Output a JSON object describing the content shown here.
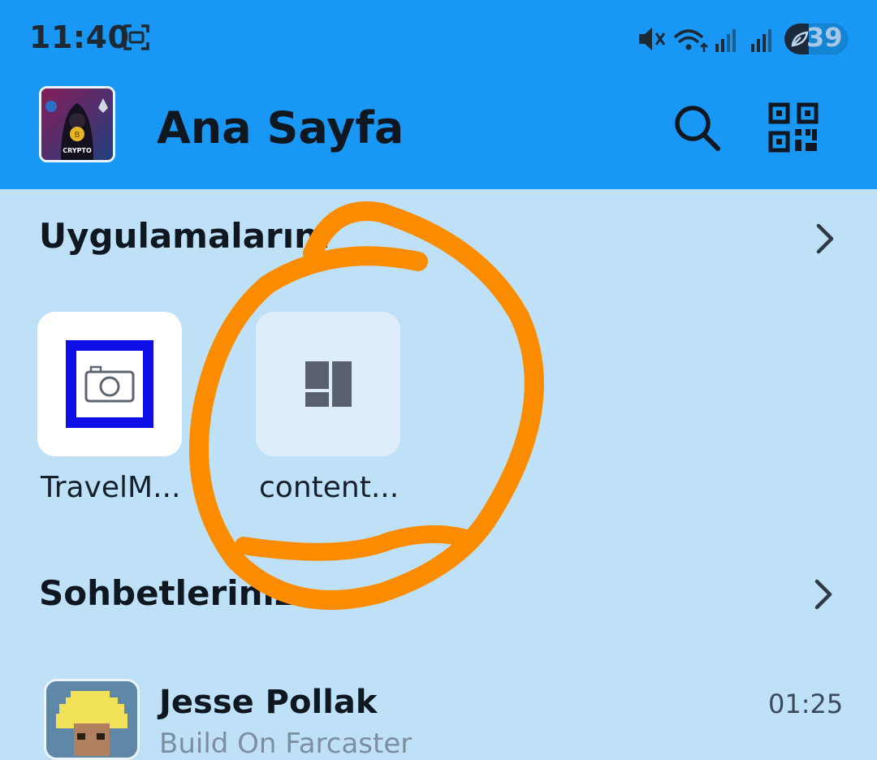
{
  "status_bar": {
    "time": "11:40",
    "battery": "39",
    "icons": [
      "screenshot-icon",
      "mute-icon",
      "wifi-icon",
      "signal-icon",
      "signal-icon",
      "battery-icon"
    ]
  },
  "header": {
    "title": "Ana Sayfa",
    "avatar_text": "MR ROBOT CRYPTO",
    "actions": [
      "search-icon",
      "qr-code-icon"
    ]
  },
  "apps_section": {
    "title": "Uygulamalarını",
    "apps": [
      {
        "label": "TravelM...",
        "icon": "camera-icon"
      },
      {
        "label": "content...",
        "icon": "layout-icon"
      }
    ]
  },
  "chats_section": {
    "title": "Sohbetleriniz",
    "chats": [
      {
        "name": "Jesse Pollak",
        "time": "01:25",
        "preview": "Build On Farcaster"
      }
    ]
  },
  "colors": {
    "header_bg": "#1997f5",
    "body_bg": "#bfe1f8",
    "annotation": "#fb8c00"
  }
}
